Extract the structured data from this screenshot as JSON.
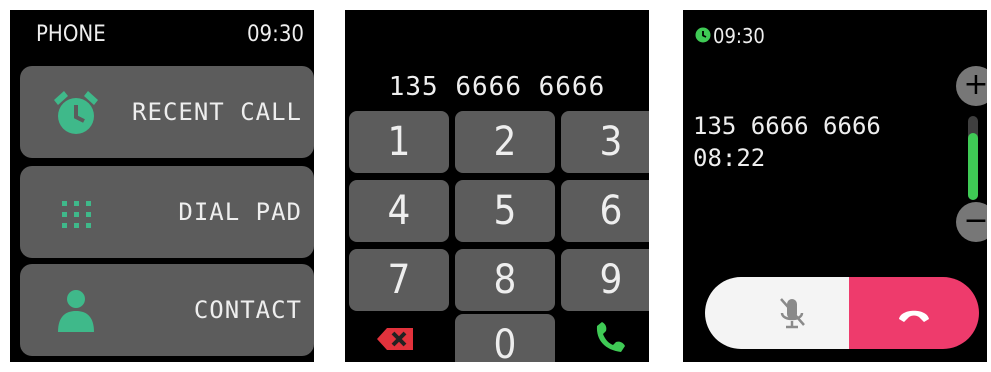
{
  "home": {
    "title": "PHONE",
    "time": "09:30",
    "menu": [
      {
        "label": "RECENT CALL",
        "icon": "alarm-clock-icon"
      },
      {
        "label": "DIAL PAD",
        "icon": "dial-pad-icon"
      },
      {
        "label": "CONTACT",
        "icon": "contact-person-icon"
      }
    ]
  },
  "dialer": {
    "number": "135 6666 6666",
    "keys": [
      "1",
      "2",
      "3",
      "4",
      "5",
      "6",
      "7",
      "8",
      "9",
      "0"
    ],
    "delete_icon": "backspace-icon",
    "call_icon": "phone-call-icon"
  },
  "in_call": {
    "time": "09:30",
    "number": "135 6666 6666",
    "duration": "08:22",
    "volume_up": "+",
    "volume_down": "−",
    "volume_level": 0.8,
    "mute_icon": "mic-muted-icon",
    "hangup_icon": "hang-up-icon"
  },
  "colors": {
    "accent_green": "#3fca55",
    "hangup_red": "#ee3b6c",
    "button_gray": "#5c5c5c"
  }
}
